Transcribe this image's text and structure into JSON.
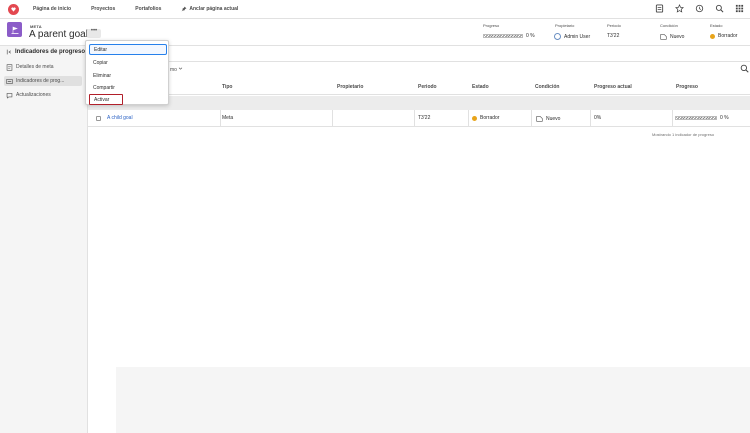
{
  "nav": {
    "items": [
      "Página de inicio",
      "Proyectos",
      "Portafolios"
    ],
    "pin_label": "Anclar página actual",
    "icons": [
      "document-icon",
      "star-icon",
      "history-icon",
      "search-icon",
      "apps-grid-icon"
    ]
  },
  "header": {
    "object_type": "META",
    "title": "A parent goal",
    "more_label": "•••",
    "stats": [
      {
        "key": "progress",
        "label": "Progreso",
        "value": "0 %",
        "progress": 0
      },
      {
        "key": "owner",
        "label": "Propietario",
        "value": "Admin User"
      },
      {
        "key": "period",
        "label": "Periodo",
        "value": "T3'22"
      },
      {
        "key": "condition",
        "label": "Condición",
        "value": "Nuevo"
      },
      {
        "key": "status",
        "label": "Estado",
        "value": "Borrador"
      }
    ]
  },
  "sidebar": {
    "heading": "Indicadores de progreso",
    "items": [
      {
        "label": "Detalles de meta"
      },
      {
        "label": "Indicadores de prog..."
      },
      {
        "label": "Actualizaciones"
      }
    ]
  },
  "menu": {
    "items": [
      "Editar",
      "Copiar",
      "Eliminar",
      "Compartir",
      "Activar"
    ]
  },
  "table": {
    "toolbar_partial": "mo",
    "columns": [
      "Tipo",
      "Propietario",
      "Periodo",
      "Estado",
      "Condición",
      "Progreso actual",
      "Progreso"
    ],
    "rows": [
      {
        "name": "A child goal",
        "type": "Meta",
        "owner": "",
        "period": "T3'22",
        "status": "Borrador",
        "condition": "Nuevo",
        "current_progress": "0%",
        "progress": "0 %",
        "progress_value": 0
      }
    ],
    "footer": "Mostrando 1 indicador de progreso"
  },
  "colors": {
    "status_draft": "#e8a41a",
    "accent": "#2680eb",
    "goal_icon": "#8b5cc8",
    "highlight": "#b11f2a"
  }
}
